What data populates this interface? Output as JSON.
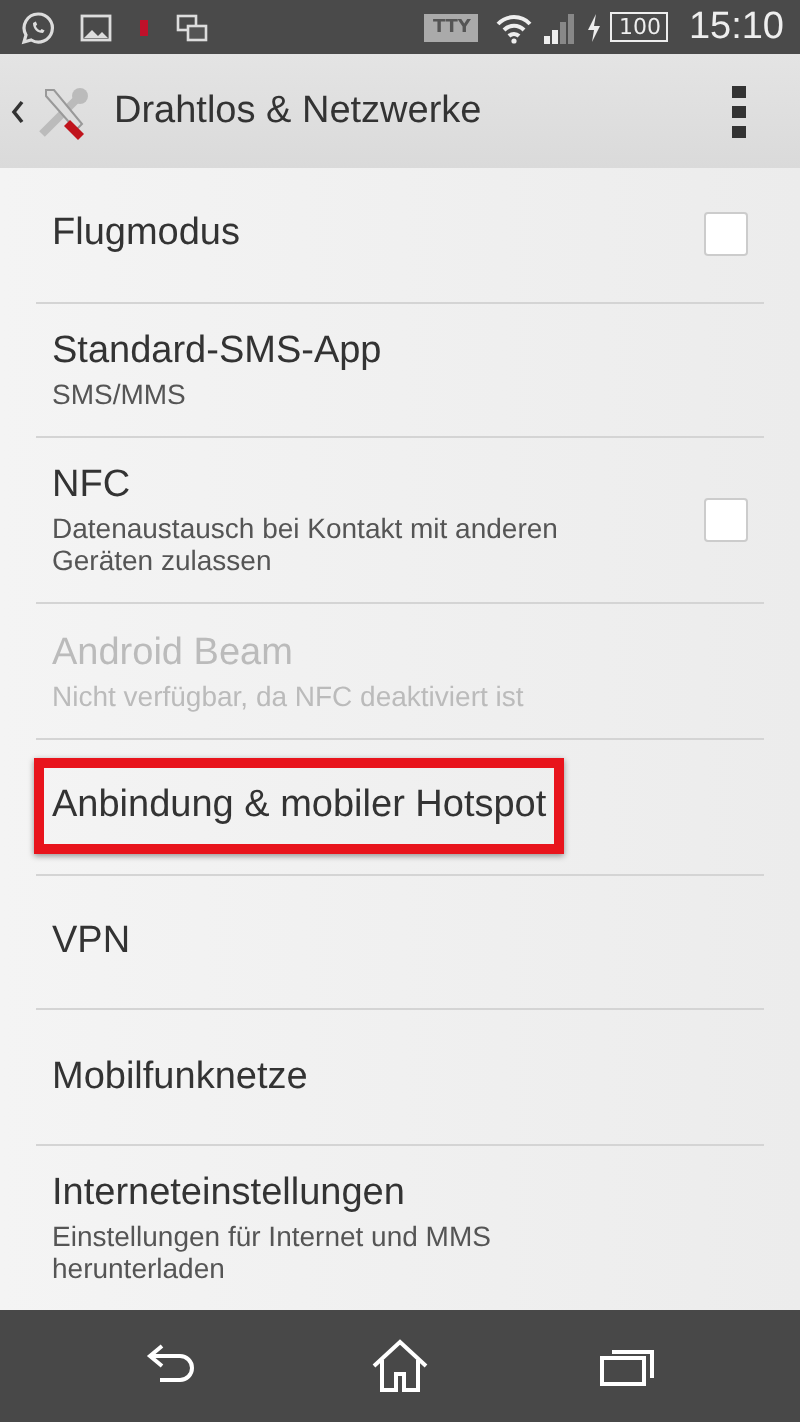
{
  "status_bar": {
    "tty": "TTY",
    "battery": "100",
    "time": "15:10"
  },
  "action_bar": {
    "title": "Drahtlos & Netzwerke"
  },
  "items": [
    {
      "kind": "checkbox",
      "title": "Flugmodus",
      "checked": false,
      "disabled": false,
      "highlighted": false
    },
    {
      "kind": "plain",
      "title": "Standard-SMS-App",
      "subtitle": "SMS/MMS",
      "disabled": false,
      "highlighted": false
    },
    {
      "kind": "checkbox",
      "title": "NFC",
      "subtitle": "Datenaustausch bei Kontakt mit anderen Geräten zulassen",
      "checked": false,
      "disabled": false,
      "highlighted": false
    },
    {
      "kind": "plain",
      "title": "Android Beam",
      "subtitle": "Nicht verfügbar, da NFC deaktiviert ist",
      "disabled": true,
      "highlighted": false
    },
    {
      "kind": "plain",
      "title": "Anbindung & mobiler Hotspot",
      "disabled": false,
      "highlighted": true
    },
    {
      "kind": "plain",
      "title": "VPN",
      "disabled": false,
      "highlighted": false
    },
    {
      "kind": "plain",
      "title": "Mobilfunknetze",
      "disabled": false,
      "highlighted": false
    },
    {
      "kind": "plain",
      "title": "Interneteinstellungen",
      "subtitle": "Einstellungen für Internet und MMS herunterladen",
      "disabled": false,
      "highlighted": false
    }
  ]
}
